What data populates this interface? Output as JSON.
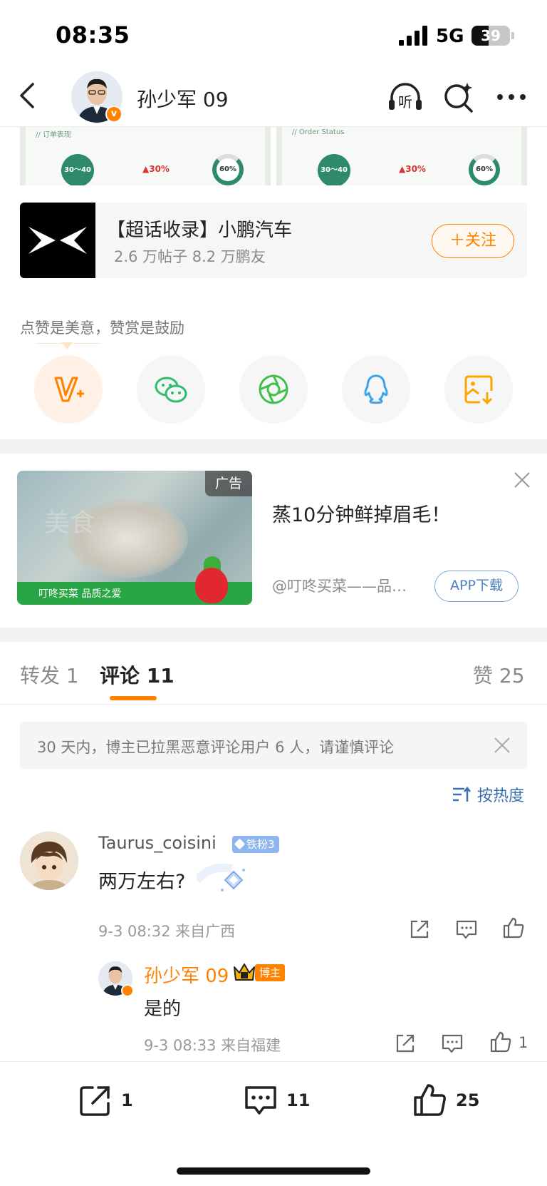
{
  "status_bar": {
    "time": "08:35",
    "network": "5G",
    "battery": "39"
  },
  "header": {
    "user_name": "孙少军 09",
    "verified_mark": "v"
  },
  "image_strip": {
    "left": {
      "caption": "// 订单表现",
      "badge": "30～40",
      "percent": "▲30%",
      "ring": "60%"
    },
    "right": {
      "caption": "// Order Status",
      "badge": "30～40",
      "percent": "▲30%",
      "ring": "60%"
    }
  },
  "topic_card": {
    "title": "【超话收录】小鹏汽车",
    "subtitle": "2.6 万帖子 8.2 万鹏友",
    "follow_label": "＋关注"
  },
  "praise": {
    "text": "点赞是美意，赞赏是鼓励"
  },
  "share_buttons": [
    {
      "icon": "reward-v-plus-icon",
      "color": "#ff8200"
    },
    {
      "icon": "wechat-icon",
      "color": "#2dbe6a"
    },
    {
      "icon": "moments-icon",
      "color": "#3fbf4b"
    },
    {
      "icon": "qq-icon",
      "color": "#3aa4ea"
    },
    {
      "icon": "save-image-icon",
      "color": "#ffa500"
    }
  ],
  "ad": {
    "tag": "广告",
    "title": "蒸10分钟鲜掉眉毛！",
    "source": "@叮咚买菜——品…",
    "download_label": "APP下载",
    "banner_text": "叮咚买菜 品质之爱",
    "watermark": "美食"
  },
  "tabs": {
    "repost": "转发 1",
    "comments": "评论 11",
    "likes": "赞 25"
  },
  "notice": {
    "text": "30 天内，博主已拉黑恶意评论用户 6 人，请谨慎评论"
  },
  "sort": {
    "label": "按热度"
  },
  "comments": [
    {
      "user": "Taurus_coisini",
      "badge": "铁粉3",
      "text": "两万左右?",
      "meta": "9-3 08:32  来自广西",
      "reply": {
        "user": "孙少军 09",
        "badge": "博主",
        "text": "是的",
        "meta": "9-3 08:33  来自福建",
        "likes": "1"
      }
    }
  ],
  "bottom_bar": {
    "reposts": "1",
    "comments": "11",
    "likes": "25"
  },
  "colors": {
    "accent": "#ff8200",
    "link": "#3b6fb0"
  }
}
